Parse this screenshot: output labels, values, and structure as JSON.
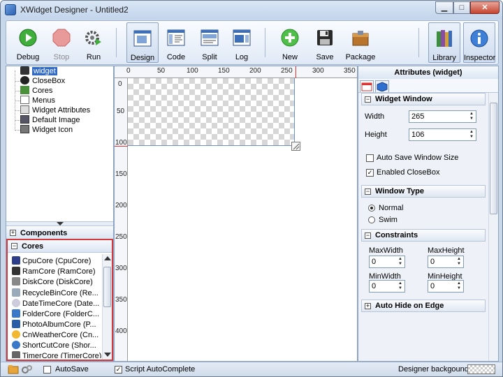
{
  "window": {
    "title": "XWidget Designer - Untitled2"
  },
  "toolbar": {
    "debug": "Debug",
    "stop": "Stop",
    "run": "Run",
    "design": "Design",
    "code": "Code",
    "split": "Split",
    "log": "Log",
    "new": "New",
    "save": "Save",
    "package": "Package",
    "library": "Library",
    "inspector": "Inspector"
  },
  "tree": {
    "items": [
      {
        "label": "widget"
      },
      {
        "label": "CloseBox"
      },
      {
        "label": "Cores"
      },
      {
        "label": "Menus"
      },
      {
        "label": "Widget Attributes"
      },
      {
        "label": "Default Image"
      },
      {
        "label": "Widget Icon"
      }
    ]
  },
  "components": {
    "header": "Components"
  },
  "cores": {
    "header": "Cores",
    "items": [
      "CpuCore (CpuCore)",
      "RamCore (RamCore)",
      "DiskCore (DiskCore)",
      "RecycleBinCore (Re...",
      "DateTimeCore (Date...",
      "FolderCore (FolderC...",
      "PhotoAlbumCore (P...",
      "CnWeatherCore (Cn...",
      "ShortCutCore (Shor...",
      "TimerCore (TimerCore)"
    ]
  },
  "ruler": {
    "h": [
      "0",
      "50",
      "100",
      "150",
      "200",
      "250",
      "300",
      "350"
    ],
    "v": [
      "0",
      "50",
      "100",
      "150",
      "200",
      "250",
      "300",
      "350",
      "400"
    ]
  },
  "attributes": {
    "title": "Attributes (widget)",
    "widget_window": {
      "header": "Widget Window",
      "width_label": "Width",
      "width": "265",
      "height_label": "Height",
      "height": "106",
      "auto_save": "Auto Save Window Size",
      "enabled_closebox": "Enabled CloseBox"
    },
    "window_type": {
      "header": "Window Type",
      "normal": "Normal",
      "swim": "Swim"
    },
    "constraints": {
      "header": "Constraints",
      "max_width_label": "MaxWidth",
      "max_width": "0",
      "max_height_label": "MaxHeight",
      "max_height": "0",
      "min_width_label": "MinWidth",
      "min_width": "0",
      "min_height_label": "MinHeight",
      "min_height": "0"
    },
    "auto_hide": {
      "header": "Auto Hide on Edge"
    }
  },
  "status": {
    "autosave": "AutoSave",
    "script_autocomplete": "Script AutoComplete",
    "designer_background": "Designer backgound"
  }
}
